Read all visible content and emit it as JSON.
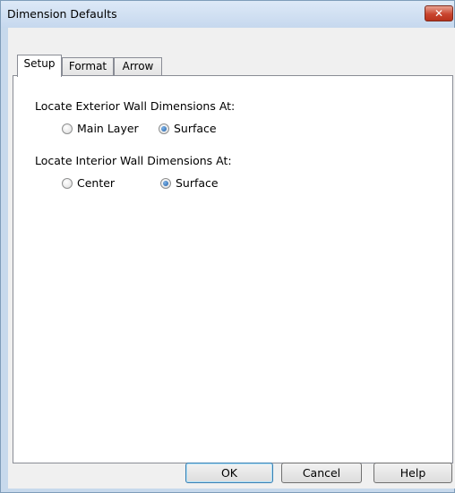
{
  "window": {
    "title": "Dimension Defaults",
    "close_glyph": "✕"
  },
  "tabs": [
    {
      "label": "Setup",
      "active": true
    },
    {
      "label": "Format",
      "active": false
    },
    {
      "label": "Arrow",
      "active": false
    }
  ],
  "setup": {
    "exterior": {
      "label": "Locate Exterior Wall Dimensions At:",
      "options": [
        {
          "label": "Main Layer",
          "checked": false
        },
        {
          "label": "Surface",
          "checked": true
        }
      ]
    },
    "interior": {
      "label": "Locate Interior Wall Dimensions At:",
      "options": [
        {
          "label": "Center",
          "checked": false
        },
        {
          "label": "Surface",
          "checked": true
        }
      ]
    }
  },
  "buttons": {
    "ok": "OK",
    "cancel": "Cancel",
    "help": "Help"
  }
}
